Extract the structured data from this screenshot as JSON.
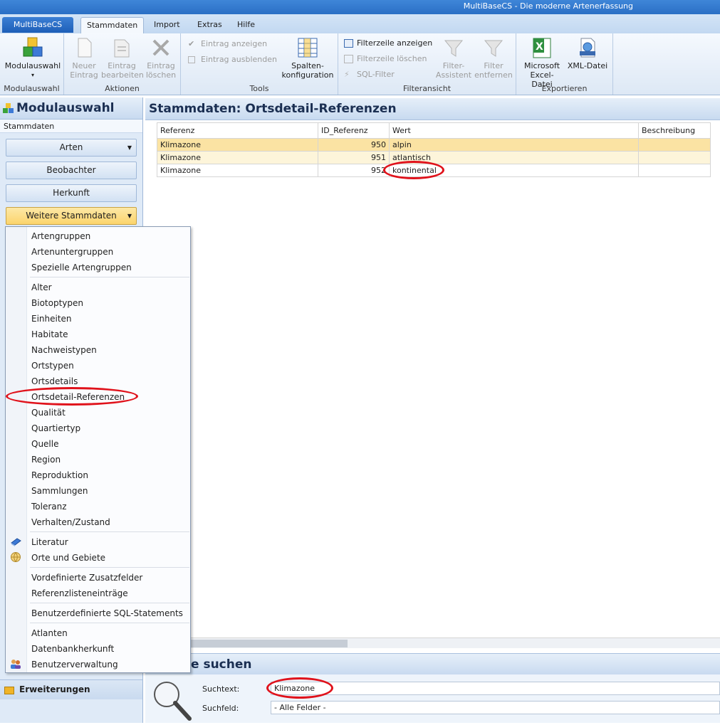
{
  "window": {
    "title": "MultiBaseCS - Die moderne Artenerfassung"
  },
  "ribbon_tabs": {
    "app": "MultiBaseCS",
    "tabs": [
      "Stammdaten",
      "Import",
      "Extras",
      "Hilfe"
    ],
    "active": "Stammdaten"
  },
  "ribbon": {
    "modulauswahl": {
      "button_line1": "Modulauswahl",
      "group": "Modulauswahl"
    },
    "aktionen": {
      "group": "Aktionen",
      "neuer": [
        "Neuer",
        "Eintrag"
      ],
      "bearbeiten": [
        "Eintrag",
        "bearbeiten"
      ],
      "loeschen": [
        "Eintrag",
        "löschen"
      ]
    },
    "tools": {
      "group": "Tools",
      "anzeigen": "Eintrag anzeigen",
      "ausblenden": "Eintrag ausblenden",
      "spalten": [
        "Spalten-",
        "konfiguration"
      ]
    },
    "filteransicht": {
      "group": "Filteransicht",
      "filterzeile_anzeigen": "Filterzeile anzeigen",
      "filterzeile_loeschen": "Filterzeile löschen",
      "sql_filter": "SQL-Filter",
      "assistent": [
        "Filter-",
        "Assistent"
      ],
      "entfernen": [
        "Filter",
        "entfernen"
      ]
    },
    "exportieren": {
      "group": "Exportieren",
      "excel": [
        "Microsoft",
        "Excel-Datei"
      ],
      "xml": "XML-Datei"
    }
  },
  "left_panel": {
    "title": "Modulauswahl",
    "subtitle": "Stammdaten",
    "buttons": [
      "Arten",
      "Beobachter",
      "Herkunft",
      "Weitere Stammdaten"
    ],
    "bottom": "Erweiterungen"
  },
  "main": {
    "title": "Stammdaten: Ortsdetail-Referenzen",
    "columns": [
      "Referenz",
      "ID_Referenz",
      "Wert",
      "Beschreibung"
    ],
    "rows": [
      {
        "referenz": "Klimazone",
        "id": "950",
        "wert": "alpin",
        "beschreibung": ""
      },
      {
        "referenz": "Klimazone",
        "id": "951",
        "wert": "atlantisch",
        "beschreibung": ""
      },
      {
        "referenz": "Klimazone",
        "id": "952",
        "wert": "kontinental",
        "beschreibung": ""
      }
    ]
  },
  "search": {
    "title_partial": "e suchen",
    "suchtext_label": "Suchtext:",
    "suchtext_value": "Klimazone",
    "suchfeld_label": "Suchfeld:",
    "suchfeld_value": "- Alle Felder -"
  },
  "menu": {
    "group1": [
      "Artengruppen",
      "Artenuntergruppen",
      "Spezielle Artengruppen"
    ],
    "group2": [
      "Alter",
      "Biotoptypen",
      "Einheiten",
      "Habitate",
      "Nachweistypen",
      "Ortstypen",
      "Ortsdetails",
      "Ortsdetail-Referenzen",
      "Qualität",
      "Quartiertyp",
      "Quelle",
      "Region",
      "Reproduktion",
      "Sammlungen",
      "Toleranz",
      "Verhalten/Zustand"
    ],
    "group3": [
      "Literatur",
      "Orte und Gebiete"
    ],
    "group4": [
      "Vordefinierte Zusatzfelder",
      "Referenzlisteneinträge"
    ],
    "group5": [
      "Benutzerdefinierte SQL-Statements"
    ],
    "group6": [
      "Atlanten",
      "Datenbankherkunft",
      "Benutzerverwaltung"
    ]
  }
}
